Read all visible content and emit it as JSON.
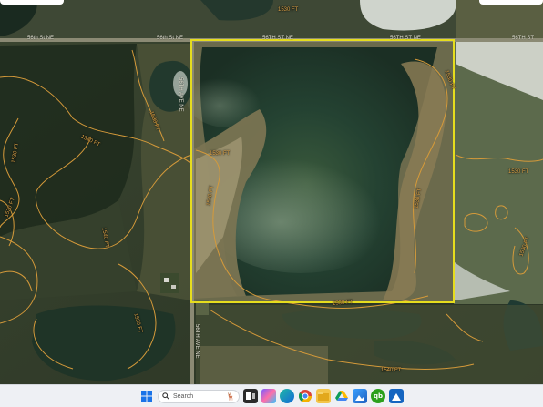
{
  "map": {
    "roads": {
      "north_left": "56th St NE",
      "north_left_2": "56th St NE",
      "north_mid": "56TH ST NE",
      "north_mid_2": "56TH ST NE",
      "north_right": "56TH ST",
      "west_vertical": "56TH AVE NE",
      "south_vertical": "56TH AVE NE"
    },
    "contours": [
      "1540 FT",
      "1530 FT",
      "1530 FT",
      "1540 FT",
      "1530 FT",
      "1530 FT",
      "1540 FT",
      "1530 FT",
      "1530 FT",
      "1530 FT",
      "1530 FT",
      "1530 FT",
      "1540 FT",
      "1530 FT",
      "1530 FT"
    ],
    "colors": {
      "boundary": "#e6dd1e",
      "contour": "#d59a3a",
      "water": "#1f3a2a"
    }
  },
  "taskbar": {
    "search_placeholder": "Search",
    "icons": [
      "windows-start-icon",
      "search-icon",
      "task-view-icon",
      "copilot-icon",
      "edge-icon",
      "chrome-icon",
      "file-explorer-icon",
      "google-drive-icon",
      "photos-icon",
      "quickbooks-icon",
      "app-icon"
    ]
  }
}
